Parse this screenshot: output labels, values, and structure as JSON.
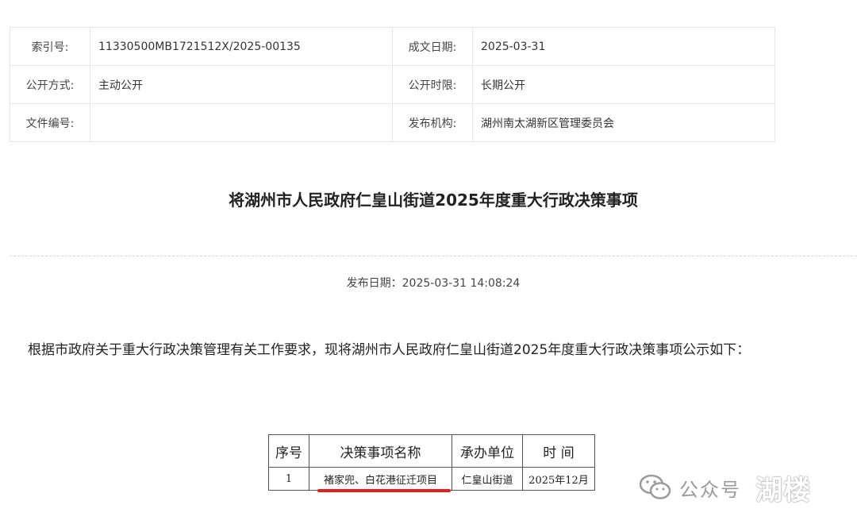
{
  "meta": {
    "row1": {
      "label1": "索引号:",
      "value1": "11330500MB1721512X/2025-00135",
      "label2": "成文日期:",
      "value2": "2025-03-31"
    },
    "row2": {
      "label1": "公开方式:",
      "value1": "主动公开",
      "label2": "公开时限:",
      "value2": "长期公开"
    },
    "row3": {
      "label1": "文件编号:",
      "value1": "",
      "label2": "发布机构:",
      "value2": "湖州南太湖新区管理委员会"
    }
  },
  "title": "将湖州市人民政府仁皇山街道2025年度重大行政决策事项",
  "pubdate": "发布日期：2025-03-31 14:08:24",
  "body": "根据市政府关于重大行政决策管理有关工作要求，现将湖州市人民政府仁皇山街道2025年度重大行政决策事项公示如下：",
  "decision_table": {
    "headers": [
      "序号",
      "决策事项名称",
      "承办单位",
      "时 间"
    ],
    "rows": [
      [
        "1",
        "褚家兜、白花港征迁项目",
        "仁皇山街道",
        "2025年12月"
      ]
    ]
  },
  "watermark": {
    "icon": "wechat-icon",
    "text": "公众号",
    "brand": "湖楼"
  }
}
